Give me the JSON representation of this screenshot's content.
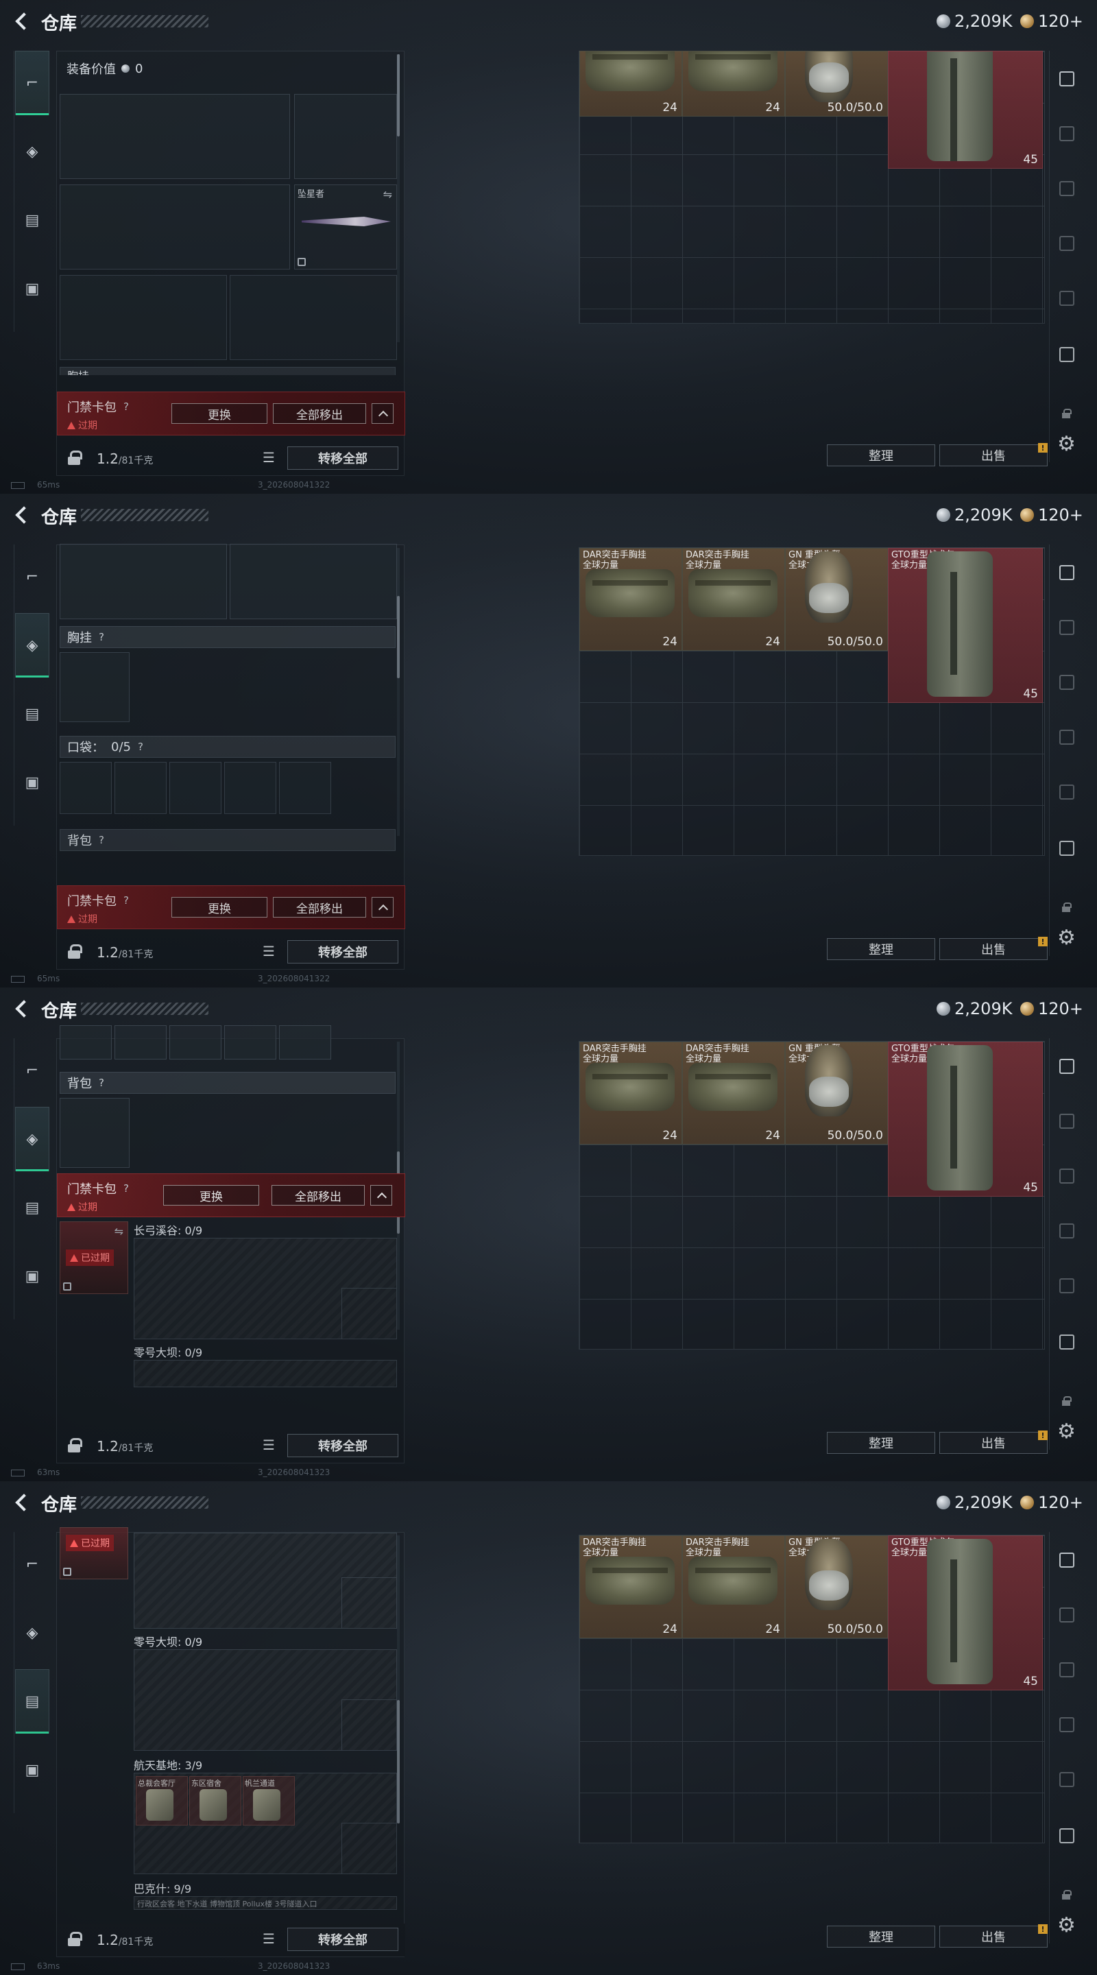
{
  "header": {
    "title": "仓库",
    "silver": "2,209K",
    "gold": "120+"
  },
  "status": {
    "frames": [
      {
        "ping": "65ms",
        "version": "3_202608041322"
      },
      {
        "ping": "65ms",
        "version": "3_202608041322"
      },
      {
        "ping": "63ms",
        "version": "3_202608041323"
      },
      {
        "ping": "63ms",
        "version": "3_202608041323"
      }
    ]
  },
  "loadout": {
    "equipment_value_label": "装备价值",
    "equipment_value": "0",
    "melee_name": "坠星者",
    "chest_rig_label": "胸挂",
    "pocket_label": "口袋：",
    "pocket_count": "0/5",
    "backpack_label": "背包",
    "chest_rig_partial": "胸挂",
    "q": "?"
  },
  "keycard": {
    "title": "门禁卡包",
    "expired": "过期",
    "replace": "更换",
    "remove_all": "全部移出",
    "expired_tag": "已过期"
  },
  "containers": [
    {
      "name": "长弓溪谷: 0/9"
    },
    {
      "name": "零号大坝: 0/9"
    },
    {
      "name": "航天基地: 3/9"
    },
    {
      "name": "巴克什: 9/9"
    }
  ],
  "mini_items": [
    "总裁会客厅",
    "东区宿舍",
    "帆兰通道"
  ],
  "bakshi_items": "行政区会客  地下水道  博物馆顶  Pollux楼  3号隧道入口",
  "footer": {
    "weight": "1.2",
    "capacity": "/81千克",
    "transfer_all": "转移全部"
  },
  "stash": {
    "items": [
      {
        "name1": "DAR突击手胸挂",
        "name2": "全球力量",
        "count": "24"
      },
      {
        "name1": "DAR突击手胸挂",
        "name2": "全球力量",
        "count": "24"
      },
      {
        "name1": "GN 重型头盔",
        "name2": "全球力量",
        "count": "50.0/50.0"
      },
      {
        "name1": "GTO重型战术包",
        "name2": "全球力量",
        "count": "45"
      }
    ],
    "sort": "整理",
    "sell": "出售",
    "notif": "!"
  },
  "colors": {
    "accent_green": "#2fd59a",
    "keycard_red": "#6b1e22",
    "expired_red": "#ff5a5a"
  }
}
